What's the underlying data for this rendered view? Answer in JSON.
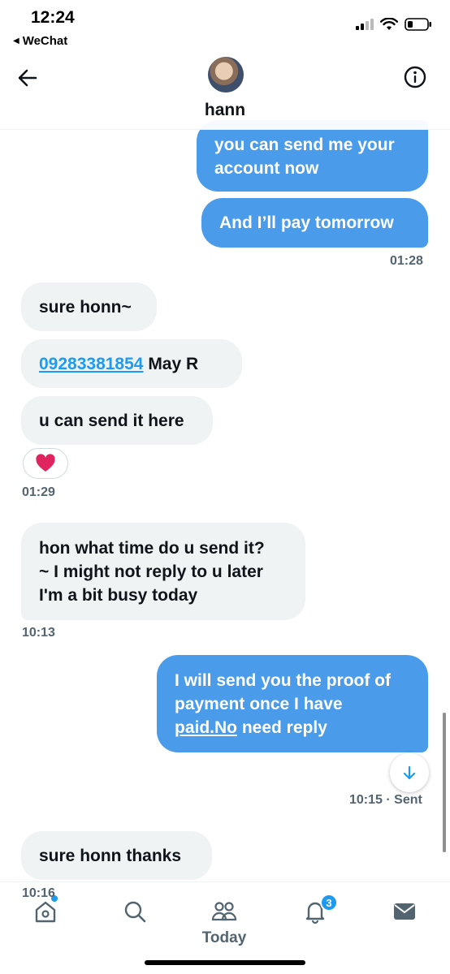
{
  "status_bar": {
    "time": "12:24",
    "back_app": "WeChat"
  },
  "header": {
    "contact_name": "hann"
  },
  "messages": {
    "m1_line1": "you can send me your",
    "m1_line2": "account now",
    "m2": "And I’ll pay tomorrow",
    "t1": "01:28",
    "m3": "sure honn~",
    "m4_link": "09283381854",
    "m4_rest": " May R",
    "m5": "u can send it here",
    "reaction": "❤️",
    "t2": "01:29",
    "m6_line1": "hon what time do u send it?",
    "m6_line2": "~ I might not reply to u later",
    "m6_line3": "I'm a bit busy today",
    "t3": "10:13",
    "m7_line1": "I will send you the proof of",
    "m7_line2": "payment once I have",
    "m7_line3_link": "paid.No",
    "m7_line3_rest": " need reply",
    "t4": "10:15 · Sent",
    "m8": "sure honn thanks",
    "t5": "10:16"
  },
  "bottom_nav": {
    "today_label": "Today",
    "notifications_badge": "3"
  },
  "colors": {
    "sent_bubble": "#4a9bea",
    "recv_bubble": "#eff3f4",
    "accent": "#1d9bf0"
  },
  "icons": [
    "back-arrow-icon",
    "info-icon",
    "home-icon",
    "search-icon",
    "communities-icon",
    "bell-icon",
    "mail-icon",
    "arrow-down-icon",
    "wifi-icon",
    "signal-icon",
    "battery-icon"
  ]
}
